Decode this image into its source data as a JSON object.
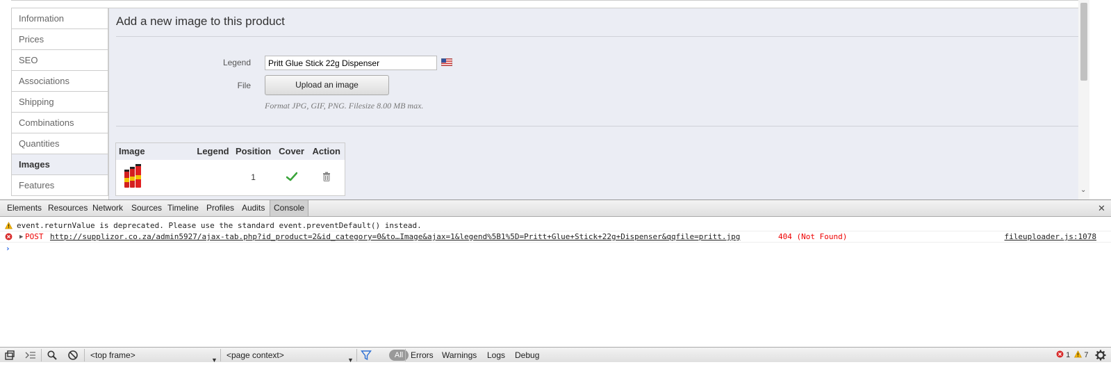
{
  "sidebar": {
    "items": [
      {
        "label": "Information"
      },
      {
        "label": "Prices"
      },
      {
        "label": "SEO"
      },
      {
        "label": "Associations"
      },
      {
        "label": "Shipping"
      },
      {
        "label": "Combinations"
      },
      {
        "label": "Quantities"
      },
      {
        "label": "Images",
        "active": true
      },
      {
        "label": "Features"
      }
    ]
  },
  "panel": {
    "title": "Add a new image to this product",
    "legend_label": "Legend",
    "legend_value": "Pritt Glue Stick 22g Dispenser",
    "file_label": "File",
    "upload_button": "Upload an image",
    "format_hint": "Format JPG, GIF, PNG. Filesize 8.00 MB max.",
    "flag_icon": "us-flag-icon"
  },
  "image_table": {
    "headers": [
      "Image",
      "Legend",
      "Position",
      "Cover",
      "Action"
    ],
    "rows": [
      {
        "legend": "",
        "position": "1",
        "cover": "check-icon",
        "action": "trash-icon"
      }
    ]
  },
  "devtools": {
    "tabs": [
      "Elements",
      "Resources",
      "Network",
      "Sources",
      "Timeline",
      "Profiles",
      "Audits",
      "Console"
    ],
    "active_tab": "Console",
    "console": {
      "warning": "event.returnValue is deprecated. Please use the standard event.preventDefault() instead.",
      "error_method": "POST",
      "error_url": "http://supplizor.co.za/admin5927/ajax-tab.php?id_product=2&id_category=0&to…Image&ajax=1&legend%5B1%5D=Pritt+Glue+Stick+22g+Dispenser&qqfile=pritt.jpg",
      "error_status": "404 (Not Found)",
      "error_source": "fileuploader.js:1078",
      "prompt": "›"
    },
    "status": {
      "frame_select": "<top frame>",
      "context_select": "<page context>",
      "filter_all": "All",
      "filters": [
        "Errors",
        "Warnings",
        "Logs",
        "Debug"
      ],
      "error_count": "1",
      "warning_count": "7"
    }
  },
  "colors": {
    "panel_bg": "#ebedf4",
    "error": "#e00000",
    "warning": "#f5b400"
  }
}
